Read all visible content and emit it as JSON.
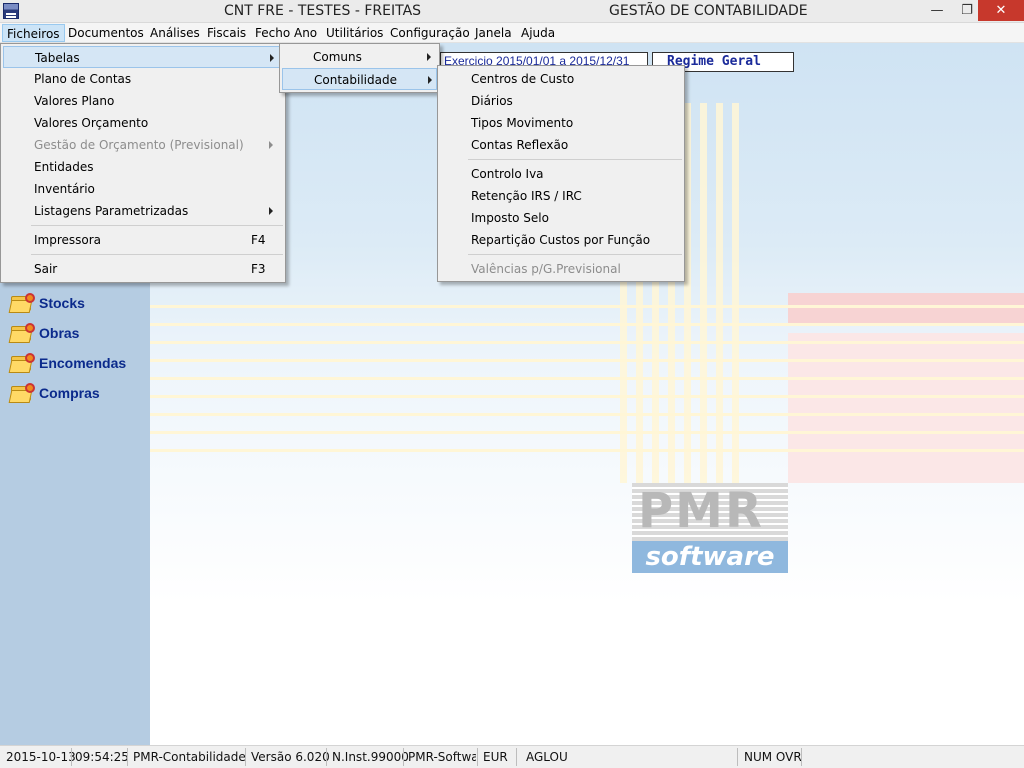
{
  "titlebar": {
    "left_title": "CNT FRE - TESTES - FREITAS",
    "right_title": "GESTÃO DE CONTABILIDADE",
    "minimize": "—",
    "maximize": "❐",
    "close": "✕"
  },
  "menubar": {
    "items": [
      "Ficheiros",
      "Documentos",
      "Análises",
      "Fiscais",
      "Fecho Ano",
      "Utilitários",
      "Configuração",
      "Janela",
      "Ajuda"
    ],
    "active": "Ficheiros"
  },
  "menu_ficheiros": {
    "items": [
      {
        "label": "Tabelas",
        "submenu": true,
        "highlighted": true
      },
      {
        "label": "Plano de Contas"
      },
      {
        "label": "Valores Plano"
      },
      {
        "label": "Valores Orçamento"
      },
      {
        "label": "Gestão de Orçamento (Previsional)",
        "submenu": true,
        "disabled": true
      },
      {
        "label": "Entidades"
      },
      {
        "label": "Inventário"
      },
      {
        "label": "Listagens Parametrizadas",
        "submenu": true
      },
      {
        "label": "Impressora",
        "shortcut": "F4"
      },
      {
        "label": "Sair",
        "shortcut": "F3"
      }
    ]
  },
  "menu_tabelas": {
    "items": [
      {
        "label": "Comuns",
        "submenu": true
      },
      {
        "label": "Contabilidade",
        "submenu": true,
        "highlighted": true
      }
    ]
  },
  "menu_contabilidade": {
    "items": [
      {
        "label": "Centros de Custo"
      },
      {
        "label": "Diários"
      },
      {
        "label": "Tipos Movimento"
      },
      {
        "label": "Contas Reflexão"
      },
      {
        "label": "Controlo Iva"
      },
      {
        "label": "Retenção IRS / IRC"
      },
      {
        "label": "Imposto Selo"
      },
      {
        "label": "Repartição Custos por Função"
      },
      {
        "label": "Valências p/G.Previsional",
        "disabled": true
      }
    ]
  },
  "sidebar": {
    "items": [
      {
        "label": "Stocks",
        "icon": "folder-gear-icon"
      },
      {
        "label": "Obras",
        "icon": "folder-gear-icon"
      },
      {
        "label": "Encomendas",
        "icon": "folder-gear-icon"
      },
      {
        "label": "Compras",
        "icon": "folder-gear-icon"
      }
    ]
  },
  "main": {
    "exercise": "Exercicio 2015/01/01 a 2015/12/31",
    "regime": "Regime Geral",
    "logo_top": "PMR",
    "logo_bottom": "software"
  },
  "statusbar": {
    "date": "2015-10-13",
    "time": "09:54:25",
    "app": "PMR-Contabilidade",
    "version": "Versão  6.020",
    "install": "N.Inst.99000",
    "company": "PMR-Softwa",
    "currency": "EUR",
    "user": "AGLOU",
    "keys": "NUM OVR"
  },
  "colors": {
    "sidebar": "#b5cce2",
    "sidebar_text": "#0b2a8c",
    "menu_highlight": "#d5e6f5",
    "close_button": "#c7382c"
  }
}
